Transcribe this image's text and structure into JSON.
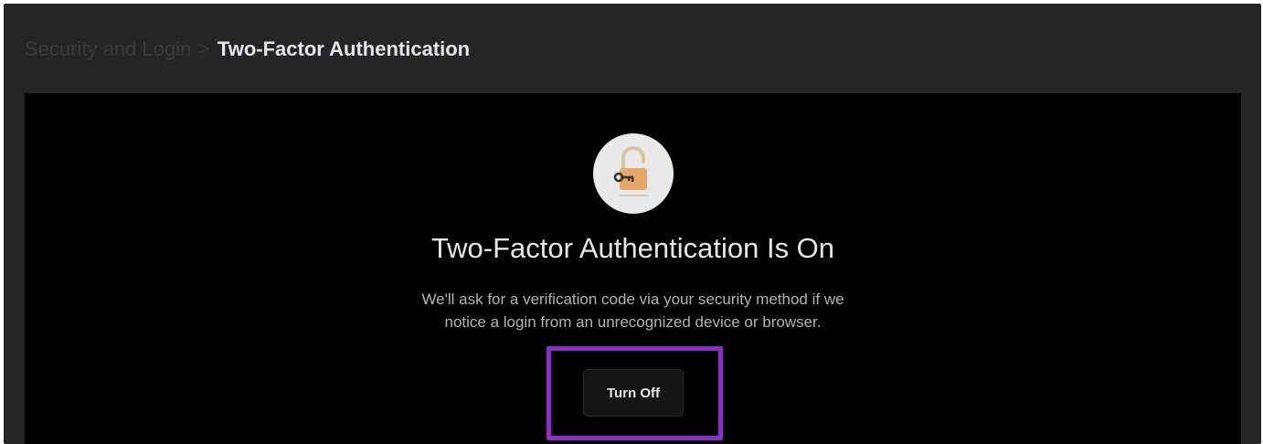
{
  "breadcrumb": {
    "parent": "Security and Login",
    "separator": ">",
    "current": "Two-Factor Authentication"
  },
  "hero": {
    "icon": "unlocked-padlock-with-key-icon",
    "title": "Two-Factor Authentication Is On",
    "description": "We'll ask for a verification code via your security method if we notice a login from an unrecognized device or browser."
  },
  "actions": {
    "turn_off_label": "Turn Off"
  },
  "colors": {
    "background": "#242526",
    "panel": "#000000",
    "highlight_border": "#8e2ec9",
    "lock_body": "#e8a76a"
  }
}
